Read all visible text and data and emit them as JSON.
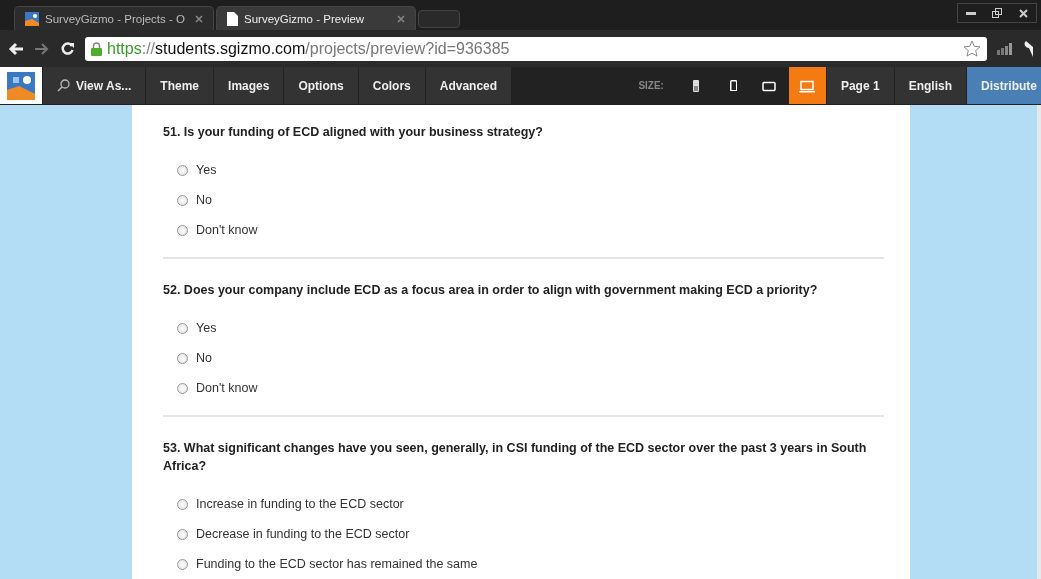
{
  "browser_tabs": [
    {
      "title": "SurveyGizmo - Projects - O",
      "selected": false,
      "kind": "logo"
    },
    {
      "title": "SurveyGizmo - Preview",
      "selected": true,
      "kind": "page"
    }
  ],
  "address": {
    "scheme": "https",
    "separator": "://",
    "host": "students.sgizmo.com",
    "path": "/projects/preview?id=936385"
  },
  "toolbar": {
    "view_as": "View As...",
    "menu": [
      "Theme",
      "Images",
      "Options",
      "Colors",
      "Advanced"
    ],
    "size_label": "SIZE:",
    "sizes": [
      {
        "kind": "phone-small",
        "selected": false
      },
      {
        "kind": "phone",
        "selected": false
      },
      {
        "kind": "tablet",
        "selected": false
      },
      {
        "kind": "laptop",
        "selected": true
      }
    ],
    "page": "Page 1",
    "language": "English",
    "distribute": "Distribute"
  },
  "questions": [
    {
      "title": "51. Is your funding of ECD aligned with your business strategy?",
      "options": [
        {
          "label": "Yes",
          "selected": false
        },
        {
          "label": "No",
          "selected": false
        },
        {
          "label": "Don't know",
          "selected": false
        }
      ]
    },
    {
      "title": "52. Does your company include ECD as a focus area in order to align with government making ECD a priority?",
      "options": [
        {
          "label": "Yes",
          "selected": false
        },
        {
          "label": "No",
          "selected": false
        },
        {
          "label": "Don't know",
          "selected": false
        }
      ]
    },
    {
      "title": "53. What significant changes have you seen, generally, in CSI funding of the ECD sector over the past 3 years in South Africa?",
      "options": [
        {
          "label": "Increase in funding to the ECD sector",
          "selected": false
        },
        {
          "label": "Decrease in funding to the ECD sector",
          "selected": false
        },
        {
          "label": "Funding to the ECD sector has remained the same",
          "selected": false
        }
      ]
    }
  ]
}
